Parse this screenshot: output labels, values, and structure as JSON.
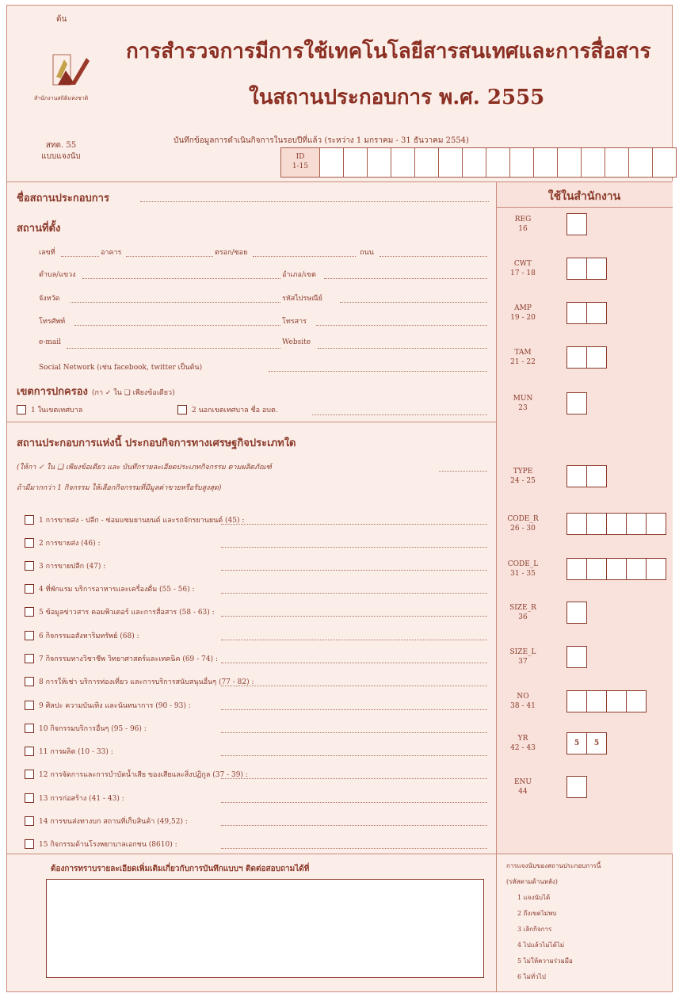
{
  "header": {
    "copy_label": "ต้น",
    "title_line1": "การสำรวจการมีการใช้เทคโนโลยีสารสนเทศและการสื่อสาร",
    "title_line2": "ในสถานประกอบการ พ.ศ. 2555",
    "logo_text": "สำนักงานสถิติแห่งชาติ",
    "form_code": "สทด. 55",
    "form_sub": "แบบแจงนับ",
    "record_note": "บันทึกข้อมูลการดำเนินกิจการในรอบปีที่แล้ว (ระหว่าง 1 มกราคม - 31 ธันวาคม 2554)",
    "id_label": "ID",
    "id_range": "1-15"
  },
  "establishment": {
    "name_label": "ชื่อสถานประกอบการ",
    "location_label": "สถานที่ตั้ง",
    "fields": {
      "house_no": "เลขที่",
      "building": "อาคาร",
      "alley": "ตรอก/ซอย",
      "road": "ถนน",
      "subdistrict": "ตำบล/แขวง",
      "district": "อำเภอ/เขต",
      "province": "จังหวัด",
      "postcode": "รหัสไปรษณีย์",
      "phone": "โทรศัพท์",
      "fax": "โทรสาร",
      "email": "e-mail",
      "website": "Website",
      "social": "Social Network (เช่น facebook, twitter เป็นต้น)"
    },
    "admin_label": "เขตการปกครอง",
    "admin_hint": "(กา ✓ ใน ❑ เพียงข้อเดียว)",
    "admin_options": [
      "1  ในเขตเทศบาล",
      "2  นอกเขตเทศบาล  ชื่อ อบต."
    ]
  },
  "activity": {
    "heading": "สถานประกอบการแห่งนี้ ประกอบกิจการทางเศรษฐกิจประเภทใด",
    "hint1": "(ให้กา ✓ ใน ❑ เพียงข้อเดียว และ บันทึกรายละเอียดประเภทกิจกรรม ตามผลิตภัณฑ์",
    "hint2": "ถ้ามีมากกว่า 1 กิจกรรม ให้เลือกกิจกรรมที่มีมูลค่าขายหรือรับสูงสุด)",
    "items": [
      "1  การขายส่ง - ปลีก - ซ่อมแซมยานยนต์ และรถจักรยานยนต์ (45) :",
      "2  การขายส่ง (46) :",
      "3  การขายปลีก (47) :",
      "4  ที่พักแรม บริการอาหารและเครื่องดื่ม (55 - 56) :",
      "5  ข้อมูลข่าวสาร คอมพิวเตอร์ และการสื่อสาร (58 - 63) :",
      "6  กิจกรรมอสังหาริมทรัพย์ (68) :",
      "7  กิจกรรมทางวิชาชีพ วิทยาศาสตร์และเทคนิค (69 - 74) :",
      "8  การให้เช่า บริการท่องเที่ยว และการบริการสนับสนุนอื่นๆ (77 - 82) :",
      "9  ศิลปะ ความบันเทิง และนันทนาการ (90 - 93) :",
      "10  กิจกรรมบริการอื่นๆ (95 - 96) :",
      "11  การผลิต (10 - 33) :",
      "12  การจัดการและการบำบัดน้ำเสีย ของเสียและสิ่งปฏิกูล (37 - 39) :",
      "13  การก่อสร้าง (41 - 43) :",
      "14  การขนส่งทางบก สถานที่เก็บสินค้า (49,52) :",
      "15  กิจกรรมด้านโรงพยาบาลเอกชน (8610) :"
    ]
  },
  "office": {
    "heading": "ใช้ในสำนักงาน",
    "codes": [
      {
        "label": "REG",
        "range": "16",
        "boxes": [
          ""
        ]
      },
      {
        "label": "CWT",
        "range": "17 - 18",
        "boxes": [
          "",
          ""
        ]
      },
      {
        "label": "AMP",
        "range": "19 - 20",
        "boxes": [
          "",
          ""
        ]
      },
      {
        "label": "TAM",
        "range": "21 - 22",
        "boxes": [
          "",
          ""
        ]
      },
      {
        "label": "MUN",
        "range": "23",
        "boxes": [
          ""
        ]
      },
      {
        "label": "TYPE",
        "range": "24 - 25",
        "boxes": [
          "",
          ""
        ]
      },
      {
        "label": "CODE_R",
        "range": "26 - 30",
        "boxes": [
          "",
          "",
          "",
          "",
          ""
        ]
      },
      {
        "label": "CODE_L",
        "range": "31 - 35",
        "boxes": [
          "",
          "",
          "",
          "",
          ""
        ]
      },
      {
        "label": "SIZE_R",
        "range": "36",
        "boxes": [
          ""
        ]
      },
      {
        "label": "SIZE_L",
        "range": "37",
        "boxes": [
          ""
        ]
      },
      {
        "label": "NO",
        "range": "38 - 41",
        "boxes": [
          "",
          "",
          "",
          ""
        ]
      },
      {
        "label": "YR",
        "range": "42 - 43",
        "boxes": [
          "5",
          "5"
        ]
      },
      {
        "label": "ENU",
        "range": "44",
        "boxes": [
          ""
        ]
      }
    ],
    "status_title": "การแจงนับของสถานประกอบการนี้",
    "status_hint": "(รหัสตามด้านหลัง)",
    "status_items": [
      "1  แจงนับได้",
      "2  ถึงเขตไม่พบ",
      "3  เลิกกิจการ",
      "4  ไปแล้วไม่ได้ไม่",
      "5  ไม่ให้ความร่วมมือ",
      "6  ไม่ทั่วไป"
    ]
  },
  "remarks": {
    "heading": "ต้องการทราบรายละเอียดเพิ่มเติมเกี่ยวกับการบันทึกแบบฯ ติดต่อสอบถามได้ที่"
  }
}
